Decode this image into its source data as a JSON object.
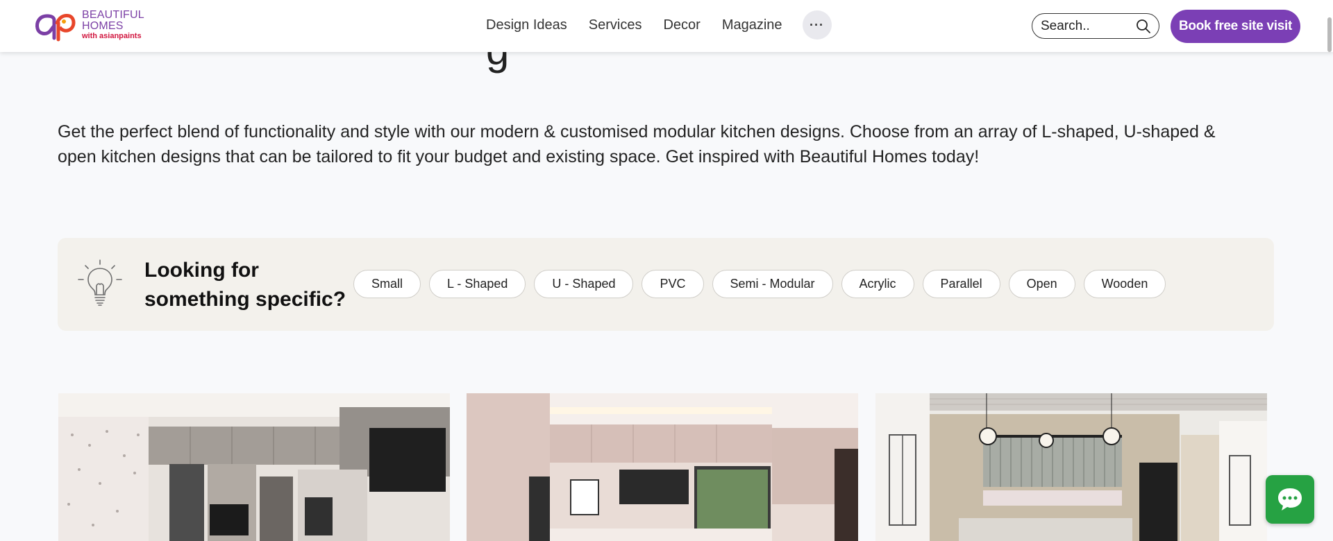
{
  "header": {
    "logo": {
      "line1": "BEAUTIFUL",
      "line2": "HOMES",
      "line3": "with asianpaints",
      "icon": "asianpaints-ap-logo"
    },
    "nav": [
      "Design Ideas",
      "Services",
      "Decor",
      "Magazine"
    ],
    "more_label": "···",
    "search_placeholder": "Search..",
    "book_label": "Book free site visit"
  },
  "page": {
    "heading_fragment": "g",
    "intro": "Get the perfect blend of functionality and style with our modern & customised modular kitchen designs. Choose from an array of L-shaped, U-shaped & open kitchen designs that can be tailored to fit your budget and existing space. Get inspired with Beautiful Homes today!"
  },
  "specific": {
    "title_line1": "Looking for",
    "title_line2": "something specific?",
    "icon": "lightbulb-icon",
    "chips": [
      "Small",
      "L - Shaped",
      "U - Shaped",
      "PVC",
      "Semi - Modular",
      "Acrylic",
      "Parallel",
      "Open",
      "Wooden"
    ]
  },
  "cards": [
    {
      "icon": "kitchen-image-grey-cabinets"
    },
    {
      "icon": "kitchen-image-pink-cabinets"
    },
    {
      "icon": "kitchen-image-island-pendant-lights"
    }
  ],
  "colors": {
    "brand_purple": "#7b3fb5",
    "chat_green": "#26a243",
    "panel_bg": "#f3f1ec"
  },
  "chat": {
    "icon": "chat-bubble-icon"
  }
}
